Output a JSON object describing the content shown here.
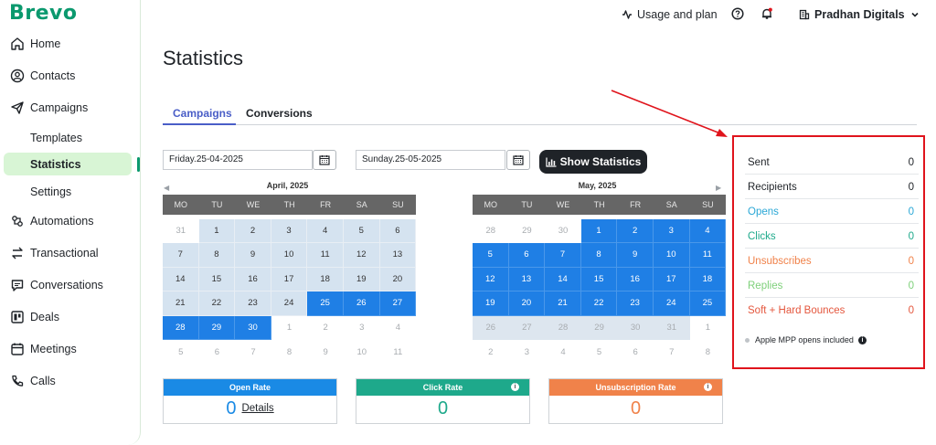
{
  "brand": {
    "logo_text": "Brevo",
    "green": "#0b996e"
  },
  "sidebar": {
    "items": [
      {
        "label": "Home",
        "icon": "home-icon"
      },
      {
        "label": "Contacts",
        "icon": "contacts-icon"
      },
      {
        "label": "Campaigns",
        "icon": "send-icon"
      },
      {
        "label": "Templates",
        "sub": true
      },
      {
        "label": "Statistics",
        "sub": true,
        "active": true
      },
      {
        "label": "Settings",
        "sub": true
      },
      {
        "label": "Automations",
        "icon": "automation-icon"
      },
      {
        "label": "Transactional",
        "icon": "transfer-icon"
      },
      {
        "label": "Conversations",
        "icon": "chat-icon"
      },
      {
        "label": "Deals",
        "icon": "deals-icon"
      },
      {
        "label": "Meetings",
        "icon": "calendar-icon"
      },
      {
        "label": "Calls",
        "icon": "phone-icon"
      }
    ]
  },
  "topbar": {
    "usage_label": "Usage and plan",
    "account_name": "Pradhan Digitals"
  },
  "page": {
    "title": "Statistics"
  },
  "tabs": [
    {
      "label": "Campaigns",
      "active": true
    },
    {
      "label": "Conversions",
      "active": false
    }
  ],
  "date_range": {
    "start": "Friday.25-04-2025",
    "end": "Sunday.25-05-2025",
    "show_button_label": "Show Statistics"
  },
  "calendars": [
    {
      "title": "April, 2025",
      "nav": "◀",
      "weekdays": [
        "MO",
        "TU",
        "WE",
        "TH",
        "FR",
        "SA",
        "SU"
      ],
      "days": [
        [
          "31",
          "out"
        ],
        [
          "1",
          "in"
        ],
        [
          "2",
          "in"
        ],
        [
          "3",
          "in"
        ],
        [
          "4",
          "in"
        ],
        [
          "5",
          "in"
        ],
        [
          "6",
          "in"
        ],
        [
          "7",
          "in"
        ],
        [
          "8",
          "in"
        ],
        [
          "9",
          "in"
        ],
        [
          "10",
          "in"
        ],
        [
          "11",
          "in"
        ],
        [
          "12",
          "in"
        ],
        [
          "13",
          "in"
        ],
        [
          "14",
          "in"
        ],
        [
          "15",
          "in"
        ],
        [
          "16",
          "in"
        ],
        [
          "17",
          "in"
        ],
        [
          "18",
          "in"
        ],
        [
          "19",
          "in"
        ],
        [
          "20",
          "in"
        ],
        [
          "21",
          "in"
        ],
        [
          "22",
          "in"
        ],
        [
          "23",
          "in"
        ],
        [
          "24",
          "in"
        ],
        [
          "25",
          "sel"
        ],
        [
          "26",
          "sel"
        ],
        [
          "27",
          "sel"
        ],
        [
          "28",
          "sel"
        ],
        [
          "29",
          "sel"
        ],
        [
          "30",
          "sel"
        ],
        [
          "1",
          "out"
        ],
        [
          "2",
          "out"
        ],
        [
          "3",
          "out"
        ],
        [
          "4",
          "out"
        ],
        [
          "5",
          "out"
        ],
        [
          "6",
          "out"
        ],
        [
          "7",
          "out"
        ],
        [
          "8",
          "out"
        ],
        [
          "9",
          "out"
        ],
        [
          "10",
          "out"
        ],
        [
          "11",
          "out"
        ]
      ]
    },
    {
      "title": "May, 2025",
      "nav": "▶",
      "weekdays": [
        "MO",
        "TU",
        "WE",
        "TH",
        "FR",
        "SA",
        "SU"
      ],
      "days": [
        [
          "28",
          "out"
        ],
        [
          "29",
          "out"
        ],
        [
          "30",
          "out"
        ],
        [
          "1",
          "sel"
        ],
        [
          "2",
          "sel"
        ],
        [
          "3",
          "sel"
        ],
        [
          "4",
          "sel"
        ],
        [
          "5",
          "sel"
        ],
        [
          "6",
          "sel"
        ],
        [
          "7",
          "sel"
        ],
        [
          "8",
          "sel"
        ],
        [
          "9",
          "sel"
        ],
        [
          "10",
          "sel"
        ],
        [
          "11",
          "sel"
        ],
        [
          "12",
          "sel"
        ],
        [
          "13",
          "sel"
        ],
        [
          "14",
          "sel"
        ],
        [
          "15",
          "sel"
        ],
        [
          "16",
          "sel"
        ],
        [
          "17",
          "sel"
        ],
        [
          "18",
          "sel"
        ],
        [
          "19",
          "sel"
        ],
        [
          "20",
          "sel"
        ],
        [
          "21",
          "sel"
        ],
        [
          "22",
          "sel"
        ],
        [
          "23",
          "sel"
        ],
        [
          "24",
          "sel"
        ],
        [
          "25",
          "sel"
        ],
        [
          "26",
          "outsel"
        ],
        [
          "27",
          "outsel"
        ],
        [
          "28",
          "outsel"
        ],
        [
          "29",
          "outsel"
        ],
        [
          "30",
          "outsel"
        ],
        [
          "31",
          "outsel"
        ],
        [
          "1",
          "out"
        ],
        [
          "2",
          "out"
        ],
        [
          "3",
          "out"
        ],
        [
          "4",
          "out"
        ],
        [
          "5",
          "out"
        ],
        [
          "6",
          "out"
        ],
        [
          "7",
          "out"
        ],
        [
          "8",
          "out"
        ]
      ]
    }
  ],
  "rates": [
    {
      "label": "Open Rate",
      "value": "0",
      "details_label": "Details",
      "color": "#1a8ae5",
      "value_color": "#1a8ae5"
    },
    {
      "label": "Click Rate",
      "value": "0",
      "color": "#1ea98b",
      "value_color": "#1ea98b"
    },
    {
      "label": "Unsubscription Rate",
      "value": "0",
      "color": "#f0824a",
      "value_color": "#f0824a"
    }
  ],
  "stats": [
    {
      "label": "Sent",
      "value": "0",
      "color": "#1f2328"
    },
    {
      "label": "Recipients",
      "value": "0",
      "color": "#1f2328"
    },
    {
      "label": "Opens",
      "value": "0",
      "color": "#2aa7d6"
    },
    {
      "label": "Clicks",
      "value": "0",
      "color": "#1ea98b"
    },
    {
      "label": "Unsubscribes",
      "value": "0",
      "color": "#f0824a"
    },
    {
      "label": "Replies",
      "value": "0",
      "color": "#7ed07a"
    },
    {
      "label": "Soft + Hard Bounces",
      "value": "0",
      "color": "#e4573e"
    }
  ],
  "mpp_note": "Apple MPP opens included"
}
